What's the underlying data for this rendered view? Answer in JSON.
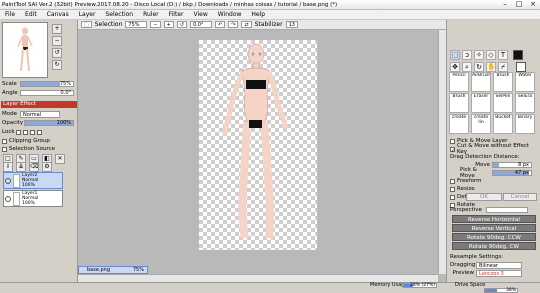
{
  "titlebar": {
    "title": "PaintTool SAI Ver.2 (32bit) Preview.2017.08.20 - Disco Local (D:) / bkp / Downloads / minhas coisas / tutorial / base.png (*)",
    "minimize": "–",
    "maximize": "□",
    "close": "×"
  },
  "menu": [
    "File",
    "Edit",
    "Canvas",
    "Layer",
    "Selection",
    "Ruler",
    "Filter",
    "View",
    "Window",
    "Help"
  ],
  "navigator": {
    "scale_label": "Scale",
    "scale_value": "75%",
    "angle_label": "Angle",
    "angle_value": "0.0°"
  },
  "layer_effect": {
    "header": "Layer Effect",
    "mode_label": "Mode",
    "mode_value": "Normal",
    "opacity_label": "Opacity",
    "opacity_value": "100%",
    "opacity_level": 1.0,
    "lock_label": "Lock",
    "clipping_label": "Clipping Group",
    "selection_source_label": "Selection Source"
  },
  "layers": [
    {
      "name": "Layer2",
      "mode": "Normal",
      "opacity": "100%",
      "selected": true
    },
    {
      "name": "Layer1",
      "mode": "Normal",
      "opacity": "100%",
      "selected": false
    }
  ],
  "canvas_toolbar": {
    "selection_label": "Selection",
    "zoom_value": "75%",
    "angle_value": "0.0°",
    "stabilizer_label": "Stabilizer",
    "stabilizer_value": "13"
  },
  "tools": {
    "brushes": [
      "Pencil",
      "AirBrush",
      "Brush",
      "Water",
      "Brush",
      "Eraser",
      "SelPen",
      "SelEra",
      "create",
      "create lin",
      "Bucket",
      "Binary"
    ]
  },
  "move_options": {
    "pick_move_layer": "Pick & Move Layer",
    "cut_move": "Cut & Move without Effect Key",
    "drag_distance": "Drag Detection Distance:",
    "move_label": "Move",
    "move_value": "8 px",
    "move_level": 0.16,
    "pick_move_label": "Pick & Move",
    "pick_move_value": "47 px",
    "pick_move_level": 0.94,
    "checkboxes": [
      "Freeform",
      "Resize",
      "Deform",
      "Rotate"
    ],
    "ok": "OK",
    "cancel": "Cancel",
    "perspective_label": "Perspective"
  },
  "transform_buttons": [
    "Reverse Horizontal",
    "Reverse Vertical",
    "Rotate 90deg. CCW",
    "Rotate 90deg. CW"
  ],
  "resample": {
    "header": "Resample Settings:",
    "dragging_label": "Dragging",
    "dragging_value": "Bilinear",
    "preview_label": "Preview",
    "preview_value": "Lanczos 3"
  },
  "tab": {
    "name": "base.png",
    "zoom": "75%"
  },
  "status": {
    "memory_label": "Memory Usage",
    "memory_value": "28% (27%)",
    "memory_level": 0.28,
    "drive_label": "Drive Space",
    "drive_value": "38%",
    "drive_level": 0.38
  },
  "colors": {
    "accent": "#c0392b",
    "selection": "#8fa8d8",
    "canvas_bg": "#b9b9b9"
  }
}
